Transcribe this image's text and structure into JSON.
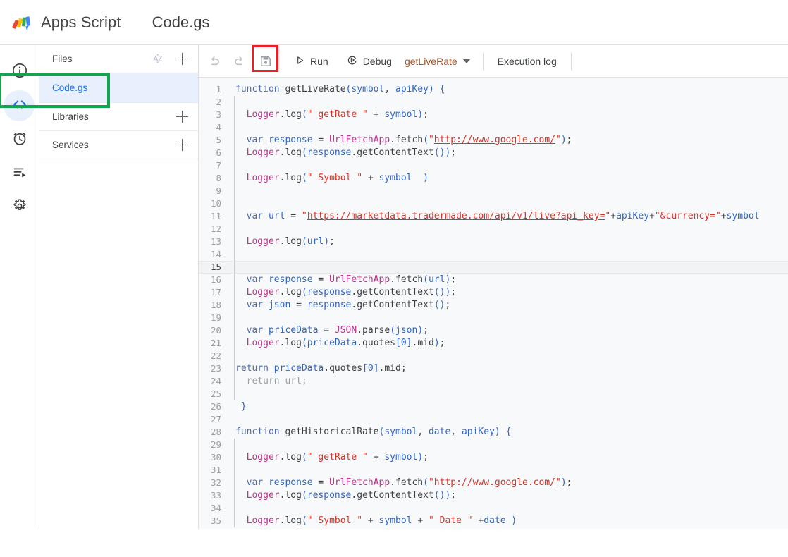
{
  "header": {
    "logo_icon": "apps-script-logo",
    "app_title": "Apps Script",
    "file_title": "Code.gs"
  },
  "rail": {
    "items": [
      {
        "icon": "info-icon",
        "name": "overview",
        "active": false
      },
      {
        "icon": "code-icon",
        "name": "editor",
        "active": true
      },
      {
        "icon": "alarm-clock-icon",
        "name": "triggers",
        "active": false
      },
      {
        "icon": "executions-icon",
        "name": "executions",
        "active": false
      },
      {
        "icon": "gear-icon",
        "name": "project-settings",
        "active": false
      }
    ]
  },
  "panel": {
    "files_label": "Files",
    "sort_icon": "sort-az-icon",
    "add_file_icon": "plus-icon",
    "file_items": [
      {
        "name": "Code.gs",
        "selected": true
      }
    ],
    "libraries_label": "Libraries",
    "add_library_icon": "plus-icon",
    "services_label": "Services",
    "add_service_icon": "plus-icon"
  },
  "toolbar": {
    "undo_icon": "undo-icon",
    "redo_icon": "redo-icon",
    "save_icon": "save-floppy-icon",
    "save_highlighted": true,
    "run_icon": "play-icon",
    "run_label": "Run",
    "debug_icon": "debug-icon",
    "debug_label": "Debug",
    "function_selected": "getLiveRate",
    "function_caret_icon": "chevron-down-icon",
    "execution_log_label": "Execution log"
  },
  "annotations": [
    {
      "name": "save-button-highlight",
      "color": "#ee1c25",
      "shape": "rect"
    },
    {
      "name": "editor-rail-highlight",
      "color": "#13a452",
      "shape": "rect"
    }
  ],
  "editor": {
    "active_line": 15,
    "first_visible_line": 1,
    "last_visible_line": 35,
    "lines": [
      {
        "n": 1,
        "tokens": [
          {
            "t": "kw",
            "v": "function"
          },
          {
            "t": "op",
            "v": " "
          },
          {
            "t": "fn",
            "v": "getLiveRate"
          },
          {
            "t": "brace",
            "v": "("
          },
          {
            "t": "var",
            "v": "symbol"
          },
          {
            "t": "op",
            "v": ", "
          },
          {
            "t": "var",
            "v": "apiKey"
          },
          {
            "t": "brace",
            "v": ")"
          },
          {
            "t": "op",
            "v": " "
          },
          {
            "t": "brace",
            "v": "{"
          }
        ]
      },
      {
        "n": 2,
        "tokens": []
      },
      {
        "n": 3,
        "tokens": [
          {
            "t": "op",
            "v": "  "
          },
          {
            "t": "obj",
            "v": "Logger"
          },
          {
            "t": "op",
            "v": "."
          },
          {
            "t": "meth",
            "v": "log"
          },
          {
            "t": "brace",
            "v": "("
          },
          {
            "t": "str",
            "v": "\" getRate \""
          },
          {
            "t": "op",
            "v": " + "
          },
          {
            "t": "var",
            "v": "symbol"
          },
          {
            "t": "brace",
            "v": ")"
          },
          {
            "t": "op",
            "v": ";"
          }
        ]
      },
      {
        "n": 4,
        "tokens": []
      },
      {
        "n": 5,
        "tokens": [
          {
            "t": "op",
            "v": "  "
          },
          {
            "t": "kw",
            "v": "var"
          },
          {
            "t": "op",
            "v": " "
          },
          {
            "t": "var",
            "v": "response"
          },
          {
            "t": "op",
            "v": " = "
          },
          {
            "t": "obj",
            "v": "UrlFetchApp"
          },
          {
            "t": "op",
            "v": "."
          },
          {
            "t": "meth",
            "v": "fetch"
          },
          {
            "t": "brace",
            "v": "("
          },
          {
            "t": "str",
            "v": "\""
          },
          {
            "t": "url",
            "v": "http://www.google.com/"
          },
          {
            "t": "str",
            "v": "\""
          },
          {
            "t": "brace",
            "v": ")"
          },
          {
            "t": "op",
            "v": ";"
          }
        ]
      },
      {
        "n": 6,
        "tokens": [
          {
            "t": "op",
            "v": "  "
          },
          {
            "t": "obj",
            "v": "Logger"
          },
          {
            "t": "op",
            "v": "."
          },
          {
            "t": "meth",
            "v": "log"
          },
          {
            "t": "brace",
            "v": "("
          },
          {
            "t": "var",
            "v": "response"
          },
          {
            "t": "op",
            "v": "."
          },
          {
            "t": "meth",
            "v": "getContentText"
          },
          {
            "t": "brace",
            "v": "()"
          },
          {
            "t": "brace",
            "v": ")"
          },
          {
            "t": "op",
            "v": ";"
          }
        ]
      },
      {
        "n": 7,
        "tokens": []
      },
      {
        "n": 8,
        "tokens": [
          {
            "t": "op",
            "v": "  "
          },
          {
            "t": "obj",
            "v": "Logger"
          },
          {
            "t": "op",
            "v": "."
          },
          {
            "t": "meth",
            "v": "log"
          },
          {
            "t": "brace",
            "v": "("
          },
          {
            "t": "str",
            "v": "\" Symbol \""
          },
          {
            "t": "op",
            "v": " + "
          },
          {
            "t": "var",
            "v": "symbol"
          },
          {
            "t": "op",
            "v": "  "
          },
          {
            "t": "brace",
            "v": ")"
          }
        ]
      },
      {
        "n": 9,
        "tokens": []
      },
      {
        "n": 10,
        "tokens": []
      },
      {
        "n": 11,
        "tokens": [
          {
            "t": "op",
            "v": "  "
          },
          {
            "t": "kw",
            "v": "var"
          },
          {
            "t": "op",
            "v": " "
          },
          {
            "t": "var",
            "v": "url"
          },
          {
            "t": "op",
            "v": " = "
          },
          {
            "t": "str",
            "v": "\""
          },
          {
            "t": "url",
            "v": "https://marketdata.tradermade.com/api/v1/live?api_key="
          },
          {
            "t": "str",
            "v": "\""
          },
          {
            "t": "op",
            "v": "+"
          },
          {
            "t": "var",
            "v": "apiKey"
          },
          {
            "t": "op",
            "v": "+"
          },
          {
            "t": "str",
            "v": "\"&currency=\""
          },
          {
            "t": "op",
            "v": "+"
          },
          {
            "t": "var",
            "v": "symbol"
          }
        ]
      },
      {
        "n": 12,
        "tokens": []
      },
      {
        "n": 13,
        "tokens": [
          {
            "t": "op",
            "v": "  "
          },
          {
            "t": "obj",
            "v": "Logger"
          },
          {
            "t": "op",
            "v": "."
          },
          {
            "t": "meth",
            "v": "log"
          },
          {
            "t": "brace",
            "v": "("
          },
          {
            "t": "var",
            "v": "url"
          },
          {
            "t": "brace",
            "v": ")"
          },
          {
            "t": "op",
            "v": ";"
          }
        ]
      },
      {
        "n": 14,
        "tokens": []
      },
      {
        "n": 15,
        "tokens": []
      },
      {
        "n": 16,
        "tokens": [
          {
            "t": "op",
            "v": "  "
          },
          {
            "t": "kw",
            "v": "var"
          },
          {
            "t": "op",
            "v": " "
          },
          {
            "t": "var",
            "v": "response"
          },
          {
            "t": "op",
            "v": " = "
          },
          {
            "t": "obj",
            "v": "UrlFetchApp"
          },
          {
            "t": "op",
            "v": "."
          },
          {
            "t": "meth",
            "v": "fetch"
          },
          {
            "t": "brace",
            "v": "("
          },
          {
            "t": "var",
            "v": "url"
          },
          {
            "t": "brace",
            "v": ")"
          },
          {
            "t": "op",
            "v": ";"
          }
        ]
      },
      {
        "n": 17,
        "tokens": [
          {
            "t": "op",
            "v": "  "
          },
          {
            "t": "obj",
            "v": "Logger"
          },
          {
            "t": "op",
            "v": "."
          },
          {
            "t": "meth",
            "v": "log"
          },
          {
            "t": "brace",
            "v": "("
          },
          {
            "t": "var",
            "v": "response"
          },
          {
            "t": "op",
            "v": "."
          },
          {
            "t": "meth",
            "v": "getContentText"
          },
          {
            "t": "brace",
            "v": "()"
          },
          {
            "t": "brace",
            "v": ")"
          },
          {
            "t": "op",
            "v": ";"
          }
        ]
      },
      {
        "n": 18,
        "tokens": [
          {
            "t": "op",
            "v": "  "
          },
          {
            "t": "kw",
            "v": "var"
          },
          {
            "t": "op",
            "v": " "
          },
          {
            "t": "var",
            "v": "json"
          },
          {
            "t": "op",
            "v": " = "
          },
          {
            "t": "var",
            "v": "response"
          },
          {
            "t": "op",
            "v": "."
          },
          {
            "t": "meth",
            "v": "getContentText"
          },
          {
            "t": "brace",
            "v": "()"
          },
          {
            "t": "op",
            "v": ";"
          }
        ]
      },
      {
        "n": 19,
        "tokens": []
      },
      {
        "n": 20,
        "tokens": [
          {
            "t": "op",
            "v": "  "
          },
          {
            "t": "kw",
            "v": "var"
          },
          {
            "t": "op",
            "v": " "
          },
          {
            "t": "var",
            "v": "priceData"
          },
          {
            "t": "op",
            "v": " = "
          },
          {
            "t": "obj",
            "v": "JSON"
          },
          {
            "t": "op",
            "v": "."
          },
          {
            "t": "meth",
            "v": "parse"
          },
          {
            "t": "brace",
            "v": "("
          },
          {
            "t": "var",
            "v": "json"
          },
          {
            "t": "brace",
            "v": ")"
          },
          {
            "t": "op",
            "v": ";"
          }
        ]
      },
      {
        "n": 21,
        "tokens": [
          {
            "t": "op",
            "v": "  "
          },
          {
            "t": "obj",
            "v": "Logger"
          },
          {
            "t": "op",
            "v": "."
          },
          {
            "t": "meth",
            "v": "log"
          },
          {
            "t": "brace",
            "v": "("
          },
          {
            "t": "var",
            "v": "priceData"
          },
          {
            "t": "op",
            "v": "."
          },
          {
            "t": "meth",
            "v": "quotes"
          },
          {
            "t": "brace",
            "v": "["
          },
          {
            "t": "num",
            "v": "0"
          },
          {
            "t": "brace",
            "v": "]"
          },
          {
            "t": "op",
            "v": "."
          },
          {
            "t": "meth",
            "v": "mid"
          },
          {
            "t": "brace",
            "v": ")"
          },
          {
            "t": "op",
            "v": ";"
          }
        ]
      },
      {
        "n": 22,
        "tokens": []
      },
      {
        "n": 23,
        "tokens": [
          {
            "t": "kw",
            "v": "return"
          },
          {
            "t": "op",
            "v": " "
          },
          {
            "t": "var",
            "v": "priceData"
          },
          {
            "t": "op",
            "v": "."
          },
          {
            "t": "meth",
            "v": "quotes"
          },
          {
            "t": "brace",
            "v": "["
          },
          {
            "t": "num",
            "v": "0"
          },
          {
            "t": "brace",
            "v": "]"
          },
          {
            "t": "op",
            "v": "."
          },
          {
            "t": "meth",
            "v": "mid"
          },
          {
            "t": "op",
            "v": ";"
          }
        ]
      },
      {
        "n": 24,
        "tokens": [
          {
            "t": "op",
            "v": "  "
          },
          {
            "t": "dim",
            "v": "return url;"
          }
        ]
      },
      {
        "n": 25,
        "tokens": []
      },
      {
        "n": 26,
        "tokens": [
          {
            "t": "op",
            "v": " "
          },
          {
            "t": "brace",
            "v": "}"
          }
        ]
      },
      {
        "n": 27,
        "tokens": []
      },
      {
        "n": 28,
        "tokens": [
          {
            "t": "kw",
            "v": "function"
          },
          {
            "t": "op",
            "v": " "
          },
          {
            "t": "fn",
            "v": "getHistoricalRate"
          },
          {
            "t": "brace",
            "v": "("
          },
          {
            "t": "var",
            "v": "symbol"
          },
          {
            "t": "op",
            "v": ", "
          },
          {
            "t": "var",
            "v": "date"
          },
          {
            "t": "op",
            "v": ", "
          },
          {
            "t": "var",
            "v": "apiKey"
          },
          {
            "t": "brace",
            "v": ")"
          },
          {
            "t": "op",
            "v": " "
          },
          {
            "t": "brace",
            "v": "{"
          }
        ]
      },
      {
        "n": 29,
        "tokens": []
      },
      {
        "n": 30,
        "tokens": [
          {
            "t": "op",
            "v": "  "
          },
          {
            "t": "obj",
            "v": "Logger"
          },
          {
            "t": "op",
            "v": "."
          },
          {
            "t": "meth",
            "v": "log"
          },
          {
            "t": "brace",
            "v": "("
          },
          {
            "t": "str",
            "v": "\" getRate \""
          },
          {
            "t": "op",
            "v": " + "
          },
          {
            "t": "var",
            "v": "symbol"
          },
          {
            "t": "brace",
            "v": ")"
          },
          {
            "t": "op",
            "v": ";"
          }
        ]
      },
      {
        "n": 31,
        "tokens": []
      },
      {
        "n": 32,
        "tokens": [
          {
            "t": "op",
            "v": "  "
          },
          {
            "t": "kw",
            "v": "var"
          },
          {
            "t": "op",
            "v": " "
          },
          {
            "t": "var",
            "v": "response"
          },
          {
            "t": "op",
            "v": " = "
          },
          {
            "t": "obj",
            "v": "UrlFetchApp"
          },
          {
            "t": "op",
            "v": "."
          },
          {
            "t": "meth",
            "v": "fetch"
          },
          {
            "t": "brace",
            "v": "("
          },
          {
            "t": "str",
            "v": "\""
          },
          {
            "t": "url",
            "v": "http://www.google.com/"
          },
          {
            "t": "str",
            "v": "\""
          },
          {
            "t": "brace",
            "v": ")"
          },
          {
            "t": "op",
            "v": ";"
          }
        ]
      },
      {
        "n": 33,
        "tokens": [
          {
            "t": "op",
            "v": "  "
          },
          {
            "t": "obj",
            "v": "Logger"
          },
          {
            "t": "op",
            "v": "."
          },
          {
            "t": "meth",
            "v": "log"
          },
          {
            "t": "brace",
            "v": "("
          },
          {
            "t": "var",
            "v": "response"
          },
          {
            "t": "op",
            "v": "."
          },
          {
            "t": "meth",
            "v": "getContentText"
          },
          {
            "t": "brace",
            "v": "()"
          },
          {
            "t": "brace",
            "v": ")"
          },
          {
            "t": "op",
            "v": ";"
          }
        ]
      },
      {
        "n": 34,
        "tokens": []
      },
      {
        "n": 35,
        "tokens": [
          {
            "t": "op",
            "v": "  "
          },
          {
            "t": "obj",
            "v": "Logger"
          },
          {
            "t": "op",
            "v": "."
          },
          {
            "t": "meth",
            "v": "log"
          },
          {
            "t": "brace",
            "v": "("
          },
          {
            "t": "str",
            "v": "\" Symbol \""
          },
          {
            "t": "op",
            "v": " + "
          },
          {
            "t": "var",
            "v": "symbol"
          },
          {
            "t": "op",
            "v": " + "
          },
          {
            "t": "str",
            "v": "\" Date \""
          },
          {
            "t": "op",
            "v": " +"
          },
          {
            "t": "var",
            "v": "date"
          },
          {
            "t": "op",
            "v": " "
          },
          {
            "t": "brace",
            "v": ")"
          }
        ]
      }
    ]
  }
}
